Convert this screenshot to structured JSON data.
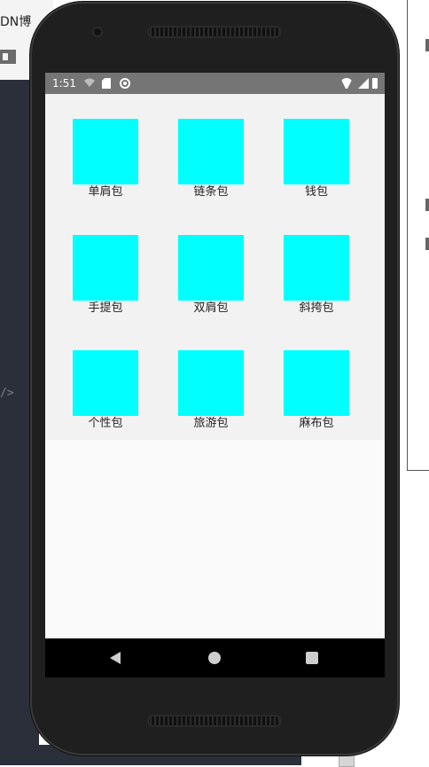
{
  "background": {
    "tab_text": "DN博"
  },
  "statusbar": {
    "time": "1:51"
  },
  "items": [
    {
      "label": "单肩包"
    },
    {
      "label": "链条包"
    },
    {
      "label": "钱包"
    },
    {
      "label": "手提包"
    },
    {
      "label": "双肩包"
    },
    {
      "label": "斜挎包"
    },
    {
      "label": "个性包"
    },
    {
      "label": "旅游包"
    },
    {
      "label": "麻布包"
    }
  ],
  "colors": {
    "item_swatch": "#00ffff",
    "statusbar": "#757575",
    "content_bg": "#f2f2f2",
    "screen_bg": "#fafafa",
    "navbar": "#000000"
  },
  "navbar": {
    "back_icon": "triangle-back-icon",
    "home_icon": "circle-home-icon",
    "recent_icon": "square-recent-icon"
  }
}
